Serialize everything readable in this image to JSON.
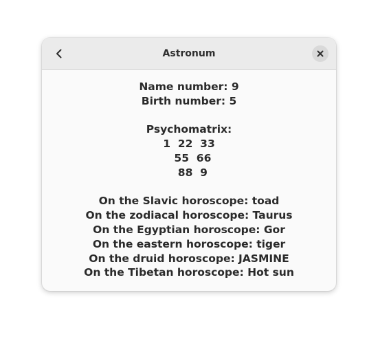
{
  "window": {
    "title": "Astronum"
  },
  "icons": {
    "back": "go-back-icon",
    "close": "window-close-icon"
  },
  "content": {
    "name_number": "Name number: 9",
    "birth_number": "Birth number: 5",
    "psychomatrix_label": "Psychomatrix:",
    "psychomatrix_rows": [
      "1  22  33",
      "  55  66",
      "  88  9"
    ],
    "horoscopes": [
      "On the Slavic horoscope: toad",
      "On the zodiacal horoscope: Taurus",
      "On the Egyptian horoscope: Gor",
      "On the eastern horoscope: tiger",
      "On the druid horoscope: JASMINE",
      "On the Tibetan horoscope: Hot sun"
    ]
  }
}
